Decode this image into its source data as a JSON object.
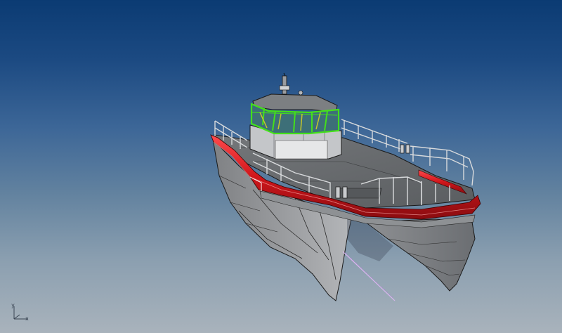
{
  "viewport": {
    "background_top": "#0b3b73",
    "background_bottom": "#a9b3bc"
  },
  "model": {
    "hull_color": "#9a9c9f",
    "deck_color": "#6a6d70",
    "fender_color": "#d0161b",
    "selection_color": "#43e01a",
    "annotation_color": "#d9b6ee"
  },
  "axis_indicator": {
    "x_label": "x",
    "y_label": "y"
  }
}
